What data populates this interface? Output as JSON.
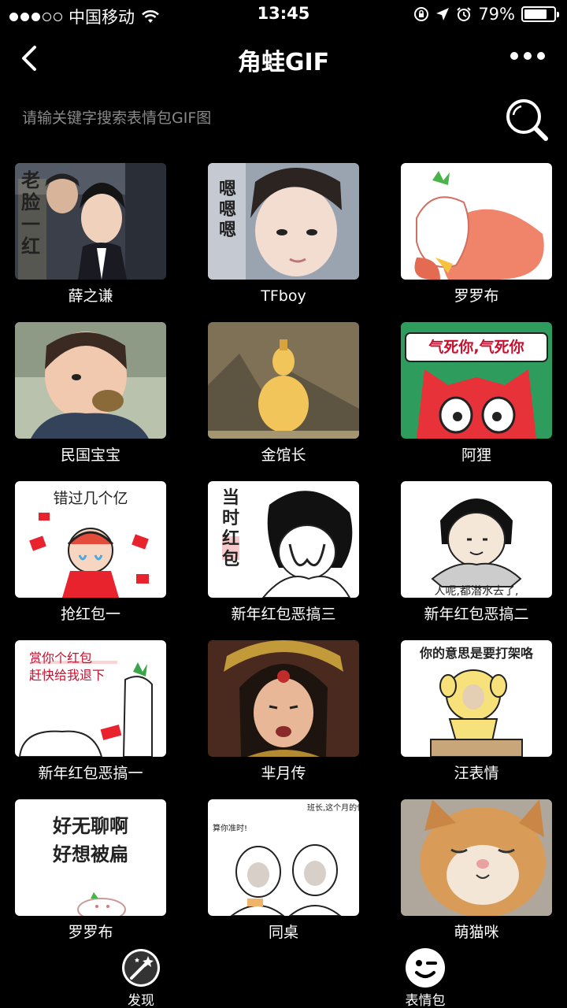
{
  "status_bar": {
    "carrier": "中国移动",
    "time": "13:45",
    "battery": "79%",
    "battery_level": 0.79
  },
  "nav": {
    "title": "角蛙GIF",
    "back_icon": "chevron-left-icon",
    "more_icon": "more-dots-icon"
  },
  "search": {
    "placeholder": "请输关键字搜索表情包GIF图",
    "icon": "search-icon"
  },
  "items": [
    {
      "label": "薛之谦",
      "overlay": "老脸一红"
    },
    {
      "label": "TFboy",
      "overlay": "嗯嗯嗯"
    },
    {
      "label": "罗罗布",
      "overlay": ""
    },
    {
      "label": "民国宝宝",
      "overlay": ""
    },
    {
      "label": "金馆长",
      "overlay": ""
    },
    {
      "label": "阿狸",
      "overlay": "气死你,气死你"
    },
    {
      "label": "抢红包一",
      "overlay": "错过几个亿"
    },
    {
      "label": "新年红包恶搞三",
      "overlay": "当时红包"
    },
    {
      "label": "新年红包恶搞二",
      "overlay": "人呢,都潜水去了,"
    },
    {
      "label": "新年红包恶搞一",
      "overlay": "赏你个红包 赶快给我退下"
    },
    {
      "label": "芈月传",
      "overlay": ""
    },
    {
      "label": "汪表情",
      "overlay": "你的意思是要打架咯"
    },
    {
      "label": "罗罗布",
      "overlay": "好无聊啊 好想被扁"
    },
    {
      "label": "同桌",
      "overlay": "算你准时! 班长,这个月的保护费!"
    },
    {
      "label": "萌猫咪",
      "overlay": ""
    }
  ],
  "tabbar": {
    "discover": "发现",
    "stickers": "表情包"
  },
  "colors": {
    "background": "#000000",
    "text": "#ffffff",
    "placeholder": "#8a8a8a"
  }
}
